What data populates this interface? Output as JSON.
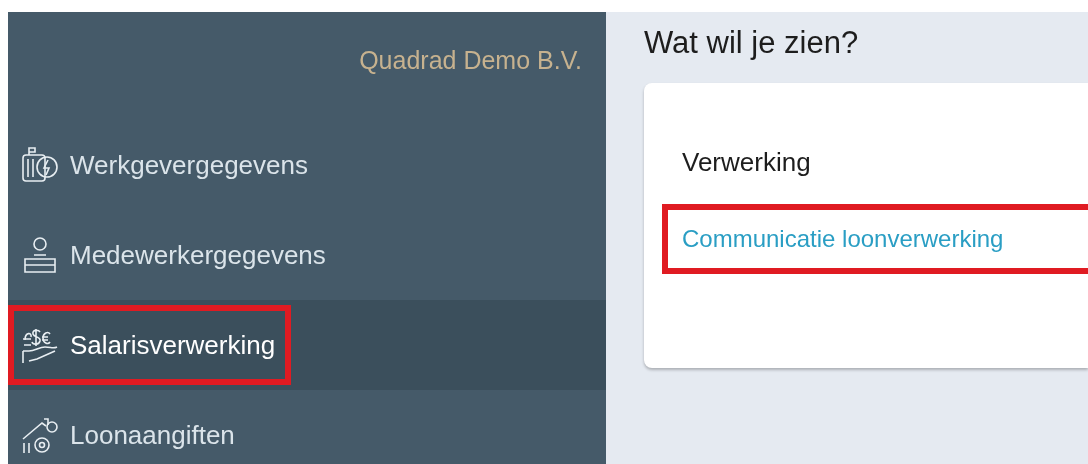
{
  "sidebar": {
    "company": "Quadrad Demo B.V.",
    "items": [
      {
        "label": "Werkgevergegevens",
        "selected": false,
        "highlighted": false
      },
      {
        "label": "Medewerkergegevens",
        "selected": false,
        "highlighted": false
      },
      {
        "label": "Salarisverwerking",
        "selected": true,
        "highlighted": true
      },
      {
        "label": "Loonaangiften",
        "selected": false,
        "highlighted": false
      }
    ]
  },
  "main": {
    "title": "Wat wil je zien?",
    "card": {
      "heading": "Verwerking",
      "links": [
        {
          "label": "Communicatie loonverwerking",
          "highlighted": true
        }
      ]
    }
  }
}
